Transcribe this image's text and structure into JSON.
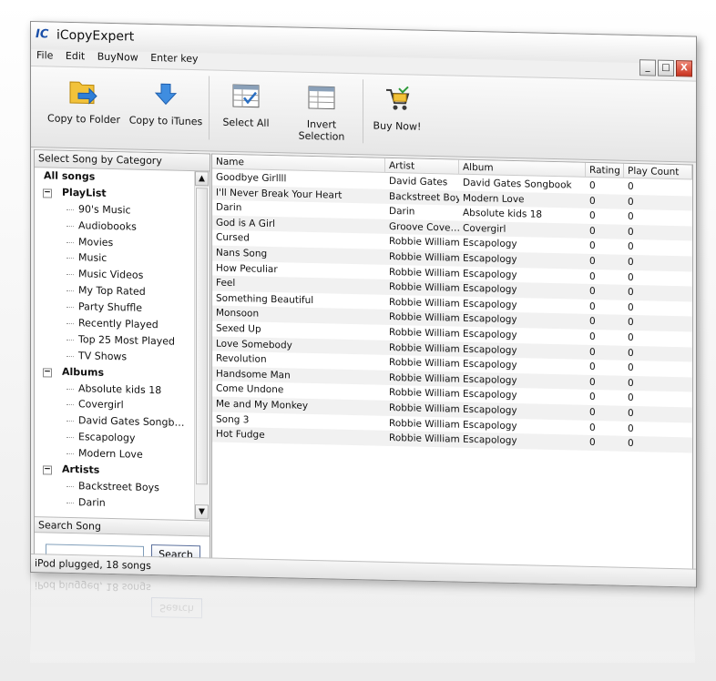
{
  "window": {
    "logo": "IC",
    "title": "iCopyExpert"
  },
  "menu": [
    "File",
    "Edit",
    "BuyNow",
    "Enter key"
  ],
  "window_buttons": {
    "minimize": "_",
    "maximize": "□",
    "close": "X"
  },
  "toolbar": {
    "copy_to_folder": "Copy to Folder",
    "copy_to_itunes": "Copy to iTunes",
    "select_all": "Select All",
    "invert_selection": "Invert Selection",
    "buy_now": "Buy Now!"
  },
  "left_panel": {
    "header": "Select Song by Category",
    "all_songs": "All songs",
    "groups": [
      {
        "label": "PlayList",
        "items": [
          "90's Music",
          "Audiobooks",
          "Movies",
          "Music",
          "Music Videos",
          "My Top Rated",
          "Party Shuffle",
          "Recently Played",
          "Top 25 Most Played",
          "TV Shows"
        ]
      },
      {
        "label": "Albums",
        "items": [
          "Absolute kids 18",
          "Covergirl",
          "David Gates Songb…",
          "Escapology",
          "Modern Love"
        ]
      },
      {
        "label": "Artists",
        "items": [
          "Backstreet Boys",
          "Darin"
        ]
      }
    ],
    "expander_symbol": "−",
    "scroll_up": "▲",
    "scroll_down": "▼"
  },
  "search": {
    "header": "Search Song",
    "value": "",
    "placeholder": "",
    "button": "Search"
  },
  "table": {
    "columns": [
      "Name",
      "Artist",
      "Album",
      "Rating",
      "Play Count"
    ],
    "rows": [
      [
        "Goodbye Girllll",
        "David Gates",
        "David Gates Songbook",
        "0",
        "0"
      ],
      [
        "I'll Never Break Your Heart",
        "Backstreet Boys",
        "Modern Love",
        "0",
        "0"
      ],
      [
        "Darin",
        "Darin",
        "Absolute kids 18",
        "0",
        "0"
      ],
      [
        "God is A Girl",
        "Groove Cove…",
        "Covergirl",
        "0",
        "0"
      ],
      [
        "Cursed",
        "Robbie Williams",
        "Escapology",
        "0",
        "0"
      ],
      [
        "Nans Song",
        "Robbie Williams",
        "Escapology",
        "0",
        "0"
      ],
      [
        "How Peculiar",
        "Robbie Williams",
        "Escapology",
        "0",
        "0"
      ],
      [
        "Feel",
        "Robbie Williams",
        "Escapology",
        "0",
        "0"
      ],
      [
        "Something Beautiful",
        "Robbie Williams",
        "Escapology",
        "0",
        "0"
      ],
      [
        "Monsoon",
        "Robbie Williams",
        "Escapology",
        "0",
        "0"
      ],
      [
        "Sexed Up",
        "Robbie Williams",
        "Escapology",
        "0",
        "0"
      ],
      [
        "Love Somebody",
        "Robbie Williams",
        "Escapology",
        "0",
        "0"
      ],
      [
        "Revolution",
        "Robbie Williams",
        "Escapology",
        "0",
        "0"
      ],
      [
        "Handsome Man",
        "Robbie Williams",
        "Escapology",
        "0",
        "0"
      ],
      [
        "Come Undone",
        "Robbie Williams",
        "Escapology",
        "0",
        "0"
      ],
      [
        "Me and My Monkey",
        "Robbie Williams",
        "Escapology",
        "0",
        "0"
      ],
      [
        "Song 3",
        "Robbie Williams",
        "Escapology",
        "0",
        "0"
      ],
      [
        "Hot Fudge",
        "Robbie Williams",
        "Escapology",
        "0",
        "0"
      ]
    ]
  },
  "status": "iPod plugged, 18 songs",
  "colors": {
    "accent": "#1a4fa8",
    "close_button": "#c8321e",
    "row_alt": "#f1f1f1"
  }
}
